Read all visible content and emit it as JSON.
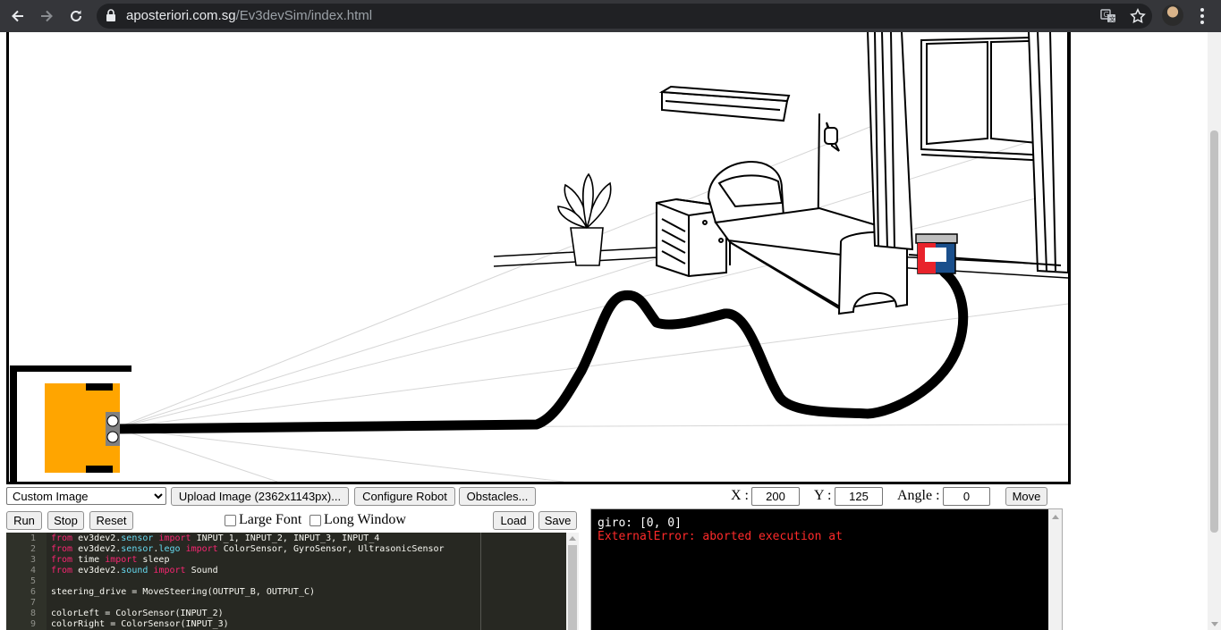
{
  "browser": {
    "url_host": "aposteriori.com.sg",
    "url_path": "/Ev3devSim/index.html"
  },
  "icons": {
    "back": "back-arrow-icon",
    "forward": "forward-arrow-icon",
    "reload": "reload-icon",
    "lock": "lock-icon",
    "translate": "translate-icon",
    "bookmark": "star-icon",
    "menu": "kebab-menu-icon"
  },
  "toolbar": {
    "image_select_value": "Custom Image",
    "upload_label": "Upload Image (2362x1143px)...",
    "configure_label": "Configure Robot",
    "obstacles_label": "Obstacles...",
    "x_label": "X :",
    "x_value": "200",
    "y_label": "Y :",
    "y_value": "125",
    "angle_label": "Angle :",
    "angle_value": "0",
    "move_label": "Move"
  },
  "controls": {
    "run_label": "Run",
    "stop_label": "Stop",
    "reset_label": "Reset",
    "large_font_label": "Large Font",
    "long_window_label": "Long Window",
    "load_label": "Load",
    "save_label": "Save"
  },
  "editor": {
    "line_numbers": [
      "1",
      "2",
      "3",
      "4",
      "5",
      "6",
      "7",
      "8",
      "9"
    ]
  },
  "console": {
    "output_line": "giro: [0, 0]",
    "error_line": "ExternalError: aborted execution at"
  },
  "colors": {
    "robot_body": "#ffa500",
    "sensor_red": "#e8232b",
    "sensor_blue": "#1a4f8c",
    "console_error": "#ff2a2a",
    "editor_bg": "#272822"
  }
}
